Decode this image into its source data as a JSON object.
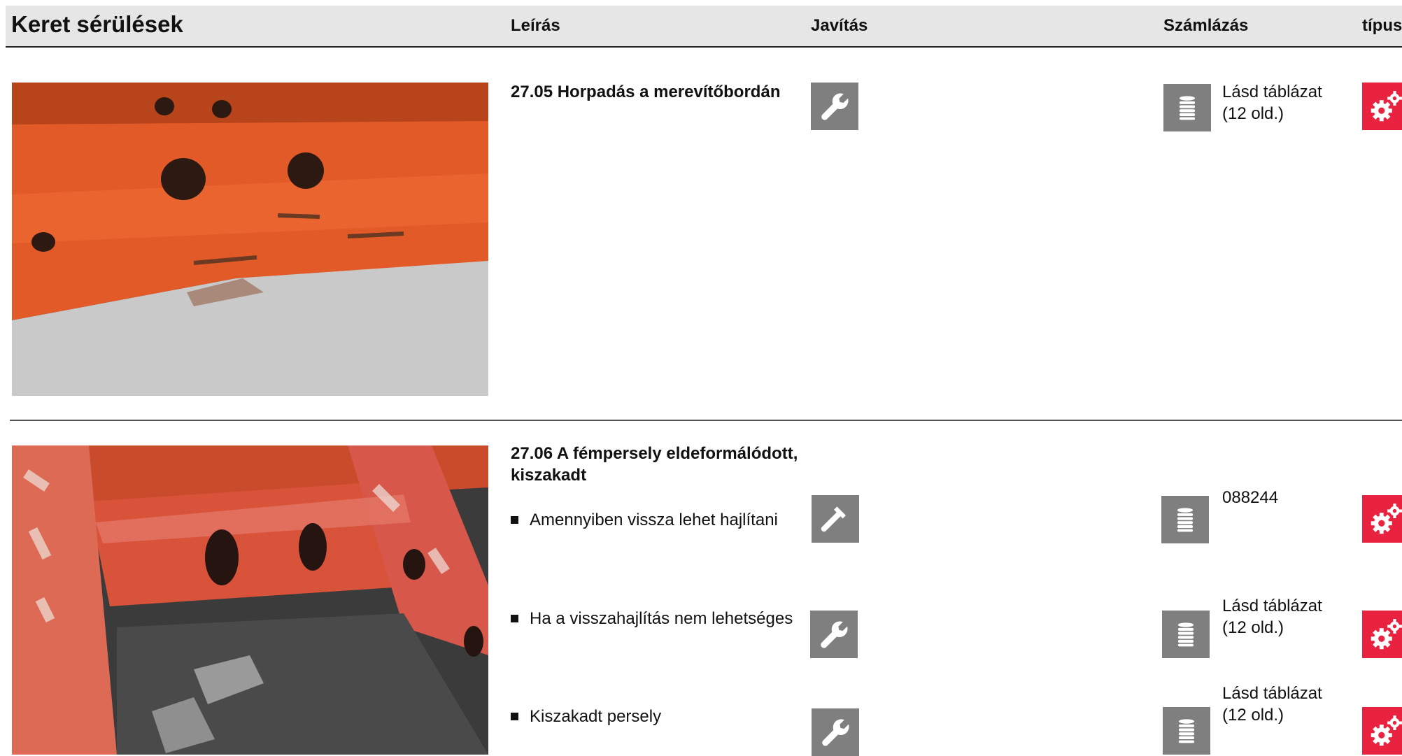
{
  "header": {
    "title": "Keret sérülések",
    "col_description": "Leírás",
    "col_repair": "Javítás",
    "col_billing": "Számlázás",
    "col_type": "típus"
  },
  "sections": [
    {
      "title": "27.05 Horpadás a merevítőbordán",
      "rows": [
        {
          "repair_icon": "wrench-icon",
          "billing_icon": "coin-stack-icon",
          "billing_note_line1": "Lásd táblázat",
          "billing_note_line2": "(12 old.)",
          "type_icon": "gears-icon"
        }
      ]
    },
    {
      "title_line1": "27.06 A fémpersely eldeformálódott,",
      "title_line2": "kiszakadt",
      "rows": [
        {
          "label": "Amennyiben vissza lehet hajlítani",
          "repair_icon": "hammer-icon",
          "billing_icon": "coin-stack-icon",
          "billing_note": "088244",
          "type_icon": "gears-icon"
        },
        {
          "label": "Ha a visszahajlítás nem lehetséges",
          "repair_icon": "wrench-icon",
          "billing_icon": "coin-stack-icon",
          "billing_note_line1": "Lásd táblázat",
          "billing_note_line2": "(12 old.)",
          "type_icon": "gears-icon"
        },
        {
          "label": "Kiszakadt persely",
          "repair_icon": "wrench-icon",
          "billing_icon": "coin-stack-icon",
          "billing_note_line1": "Lásd táblázat",
          "billing_note_line2": "(12 old.)",
          "type_icon": "gears-icon"
        }
      ]
    }
  ],
  "colors": {
    "header_bg": "#e6e6e6",
    "icon_grey": "#7f7f7f",
    "icon_red": "#e8223f"
  }
}
